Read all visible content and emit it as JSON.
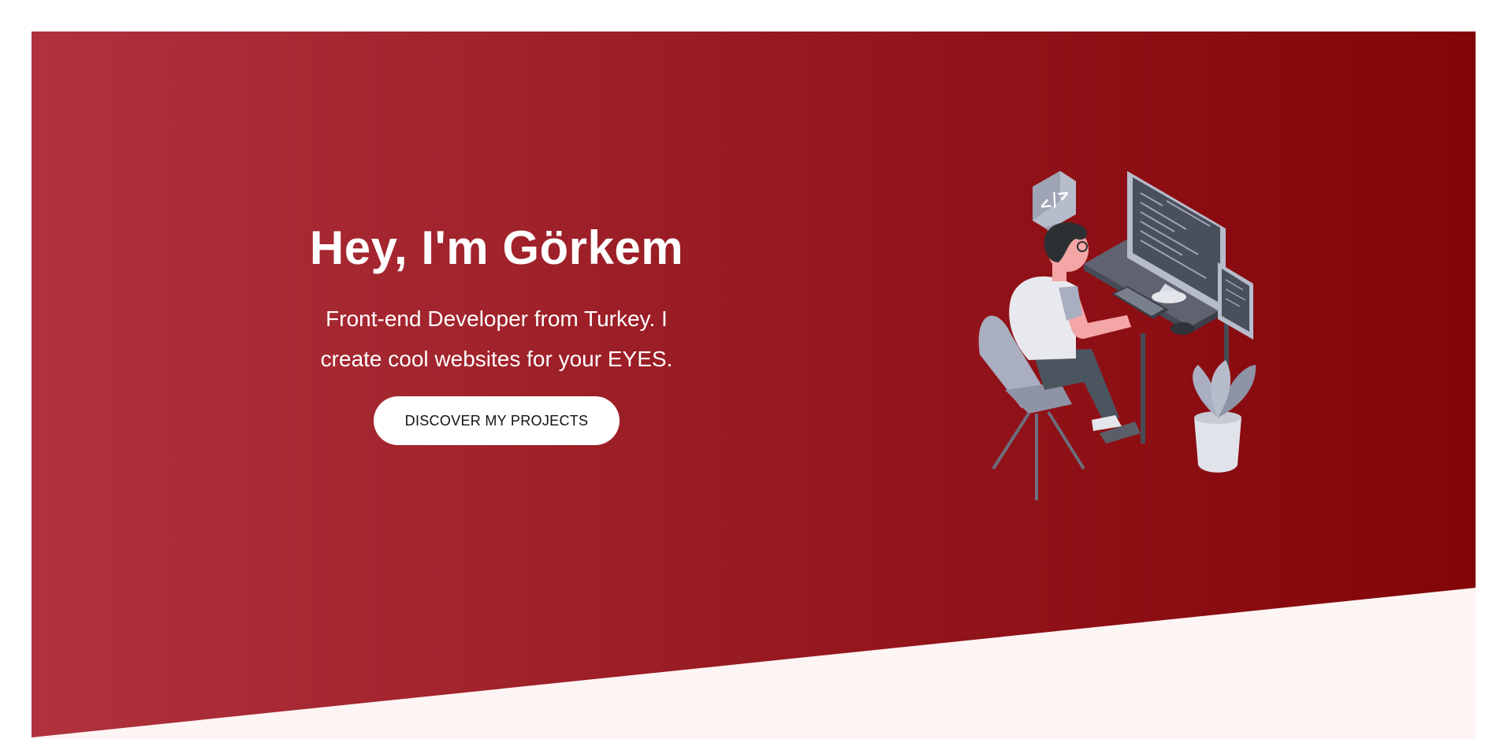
{
  "hero": {
    "title": "Hey, I'm Görkem",
    "subtitle": "Front-end Developer from Turkey. I create cool websites for your EYES.",
    "cta_label": "DISCOVER MY PROJECTS",
    "code_badge": "</>"
  },
  "colors": {
    "gradient_start": "#b0323d",
    "gradient_end": "#820508",
    "below_fold": "#fdf4f4",
    "button_bg": "#ffffff",
    "button_text": "#111111"
  },
  "icons": {
    "illustration": "developer-at-desk-illustration",
    "code_badge": "code-tag-icon"
  }
}
